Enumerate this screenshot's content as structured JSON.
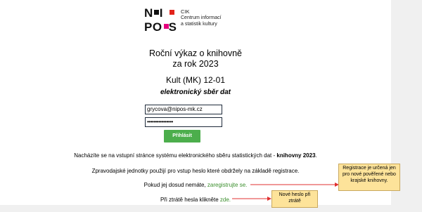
{
  "logo": {
    "letters_row1": "N",
    "letters_row1_b": "I",
    "letters_row2": "PO",
    "letters_row2_b": "S",
    "brand_line1": "CIK",
    "brand_line2": "Centrum informací",
    "brand_line3": "a statistik kultury"
  },
  "header": {
    "title_line1": "Roční výkaz o knihovně",
    "title_line2": "za rok 2023",
    "form_code": "Kult (MK) 12-01",
    "subtitle": "elektronický sběr dat"
  },
  "login": {
    "email_value": "grycova@nipos-mk.cz",
    "password_value": "••••••••••••••••",
    "submit_label": "Přihlásit"
  },
  "info": {
    "line1_text": "Nacházíte se na vstupní stránce systému elektronického sběru statistických dat - ",
    "line1_bold": "knihovny 2023",
    "line1_end": ".",
    "line2": "Zpravodajské jednotky použijí pro vstup heslo které obdržely na základě registrace.",
    "line3_text": "Pokud jej dosud nemáte, ",
    "line3_link": "zaregistrujte se.",
    "line4_text": "Při ztrátě hesla klikněte ",
    "line4_link": "zde."
  },
  "notes": {
    "registration": [
      "Registrace je určená jen",
      "pro nové pověřené nebo",
      "krajské knihovny."
    ],
    "new_password": [
      "Nové heslo při",
      "ztrátě"
    ]
  },
  "colors": {
    "login_button": "#4cae4c",
    "link": "#3a8e2c",
    "note_bg": "#fde39a",
    "arrow": "#e03030",
    "logo_red": "#e2231a",
    "logo_pink": "#e6007e"
  }
}
